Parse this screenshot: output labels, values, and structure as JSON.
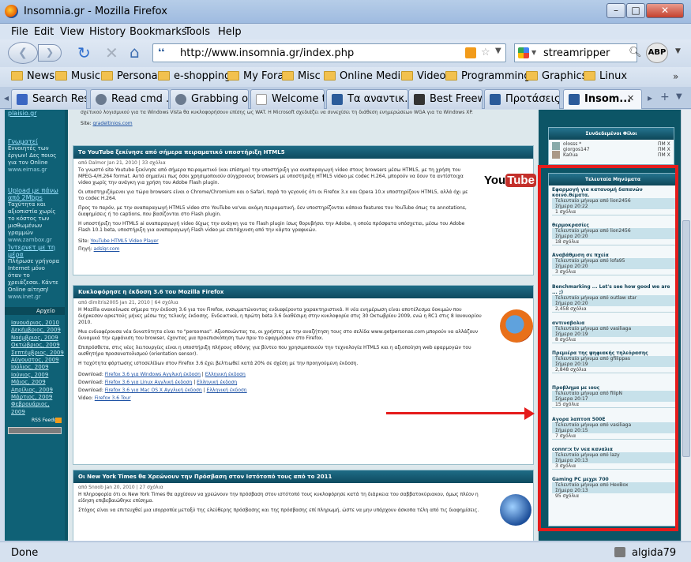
{
  "window": {
    "title": "Insomnia.gr - Mozilla Firefox"
  },
  "menubar": [
    "File",
    "Edit",
    "View",
    "History",
    "Bookmarks",
    "Tools",
    "Help"
  ],
  "navbar": {
    "url": "http://www.insomnia.gr/index.php",
    "search_value": "streamripper",
    "abp": "ABP"
  },
  "bookmarks": [
    "News",
    "Music",
    "Personal",
    "e-shopping",
    "My Fora",
    "Misc",
    "Online Media",
    "Video",
    "Programming",
    "Graphics",
    "Linux"
  ],
  "tabs": [
    "Search Res...",
    "Read cmd ...",
    "Grabbing o...",
    "Welcome t...",
    "Τα αναντικ...",
    "Best Freew...",
    "Προτάσεις...",
    "Insom..."
  ],
  "status": {
    "left": "Done",
    "right": "algida79"
  },
  "leftcol": {
    "top": "plaisio.gr",
    "ads": [
      {
        "title": "Γνωματεί",
        "text": "Εννοιητές των έργων! Δες ποιος για τον Online",
        "src": "www.eirnas.gr"
      },
      {
        "title": "Upload με πάνω από 2Mbps",
        "text": "Ταχύτητα και αξιοπιστία χωρίς το κόστος των μισθωμένων γραμμών",
        "src": "www.zambox.gr"
      },
      {
        "title": "Ίντερνετ με τη μέρα",
        "text": "Πλήρωσε γρήγορα Internet μόνο όταν το χρειάζεσαι. Κάντε Online αίτηση!",
        "src": "www.inet.gr"
      }
    ],
    "archive_title": "Αρχείο",
    "archive": [
      "Ιανουάριος, 2010",
      "Δεκέμβριος, 2009",
      "Νοέμβριος, 2009",
      "Οκτώβριος, 2009",
      "Σεπτέμβριος, 2009",
      "Αύγουστος, 2009",
      "Ιούλιος, 2009",
      "Ιούνιος, 2009",
      "Μάιος, 2009",
      "Απρίλιος, 2009",
      "Μάρτιος, 2009",
      "Φεβρουάριος, 2009"
    ],
    "rss": "RSS Feeds"
  },
  "posts": [
    {
      "title": "Το YouTube ξεκίνησε από σήμερα πειραματικό υποστήριξη HTML5",
      "meta": "από Dalmor Jan 21, 2010 | 33 σχόλια",
      "logo": "YouTube",
      "paras": [
        "Το γνωστό site Youtube ξεκίνησε από σήμερα πειραματικό (και επίσημο) την υποστήριξη για αναπαραγωγή video στους browsers μέσω HTML5, με τη χρήση του MPEG-4/H.264 format. Αυτό σημαίνει πως όσοι χρησιμοποιούν σύγχρονους browsers με υποστήριξη HTML5 video με codec H.264, μπορούν να δουν τα αντίστοιχα video χωρίς την ανάγκη για χρήση του Adobe Flash plugin.",
        "Οι υποστηριζόμενοι για τώρα browsers είναι ο Chrome/Chromium και ο Safari, παρά το γεγονός ότι οι Firefox 3.x και Opera 10.x υποστηρίζουν HTML5, αλλά όχι με το codec H.264.",
        "Προς το παρόν, με την αναπαραγωγή HTML5 video στο YouTube να'ναι ακόμη πειραματική, δεν υποστηρίζονται κάποια features του YouTube όπως τα annotations, διαφημίσεις ή το captions, που βασίζονται στο Flash plugin.",
        "Η υποστήριξη του HTML5 ai αναπαραγωγή video δίχως την ανάγκη για το Flash plugin ίσως θορυβήσει την Adobe, η οποία πρόσφατα υπόσχεται, μέσω του Adobe Flash 10.1 beta, υποστήριξη για αναπαραγωγή Flash video με επιτάχυνση από την κάρτα γραφικών."
      ],
      "links": [
        {
          "label": "Site:",
          "text": "YouTube HTML5 Video Player"
        },
        {
          "label": "Πηγή:",
          "text": "adslgr.com"
        }
      ]
    },
    {
      "title": "Κυκλοφόρησε η έκδοση 3.6 του Mozilla Firefox",
      "meta": "από dimitris2005 Jan 21, 2010 | 64 σχόλια",
      "paras": [
        "Η Mozilla ανακοίνωσε σήμερα την έκδοση 3.6 για τον Firefox, ενσωματώνοντας ενδιαφέροντα χαρακτηριστικά. Η νέα ενημέρωση είναι αποτέλεσμα δοκιμών που διήρκεσαν αρκετούς μήνες μέσω της τελικής έκδοσης. Ενδεικτικά, η πρώτη beta 3.6 διαθέσιμη στην κυκλοφορία στις 30 Οκτωβρίου 2009, ενώ η RC1 στις 8 Ιανουαρίου 2010.",
        "Μια ενδιαφέρουσα νέα δυνατότητα είναι το \"persomas\". Αξιοποιώντας τα, οι χρήστες με την αναζήτηση τους στο σελίδα www.getpersonas.com μπορούν να αλλάζουν δυναμικά την εμφάνιση του browser, έχοντας μια προεπισκόπηση των πριν το εφαρμόσουν στο Firefox.",
        "Επιπρόσθετα, στις νέες λειτουργίες είναι η υποστήριξη πλήρους οθόνης για βίντεο που χρησιμοποιούν την τεχνολογία HTML5 και η αξιοποίηση web εφαρμογών του αισθητήρα προσανατολισμού (orientation sensor).",
        "Η ταχύτητα φόρτωσης ιστοσελίδων στον Firefox 3.6 έχει βελτιωθεί κατά 20% σε σχέση με την προηγούμενη έκδοση."
      ],
      "downloads": [
        {
          "label": "Download:",
          "links": [
            "Firefox 3.6 για Windows Αγγλική έκδοση",
            "Ελληνική έκδοση"
          ]
        },
        {
          "label": "Download:",
          "links": [
            "Firefox 3.6 για Linux Αγγλική έκδοση",
            "Ελληνική έκδοση"
          ]
        },
        {
          "label": "Download:",
          "links": [
            "Firefox 3.6 για Mac OS X Αγγλική έκδοση",
            "Ελληνική έκδοση"
          ]
        },
        {
          "label": "Video:",
          "links": [
            "Firefox 3.6 Tour"
          ]
        }
      ]
    },
    {
      "title": "Οι New York Times θα Χρεώνουν την Πρόσβαση στον Ιστότοπό τους από το 2011",
      "meta": "από Snoob Jan 20, 2010 | 27 σχόλια",
      "paras": [
        "Η πληροφορία ότι οι New York Times θα αρχίσουν να χρεώνουν την πρόσβαση στον ιστότοπό τους κυκλοφόρησε κατά τη διάρκεια του σαββατοκύριακου, όμως πλέον η είδηση επιβεβαιώθηκε επίσημα.",
        "Στόχος είναι να επιτευχθεί μια ισορροπία μεταξύ της ελεύθερης πρόσβασης και της πρόσβασης επί πληρωμή, ώστε να μην υπάρχουν άσκοπα τέλη από τις διαφημίσεις."
      ]
    }
  ],
  "friends": {
    "title": "Συνδεδεμένοι Φίλοι",
    "items": [
      {
        "name": "olosss *",
        "action": "ΠΜ X"
      },
      {
        "name": "giorgos147",
        "action": "ΠΜ X"
      },
      {
        "name": "Ka0ua",
        "action": "ΠΜ X"
      }
    ]
  },
  "latest": {
    "title": "Τελευταία Μηνύματα",
    "items": [
      {
        "title": "Εφαρμογή για κατανομή δαπανών κοινό.θεματα.",
        "line": "Τελευταίο μήνυμα από lion2456",
        "time": "Σήμερα 20:22",
        "comments": "1 σχόλια"
      },
      {
        "title": "θερμοκρασίες",
        "line": "Τελευταίο μήνυμα από lion2456",
        "time": "Σήμερα 20:20",
        "comments": "18 σχόλια"
      },
      {
        "title": "Αναβάθμιση σε πχεία",
        "line": "Τελευταίο μήνυμα από lofa95",
        "time": "Σήμερα 20:20",
        "comments": "3 σχόλια"
      },
      {
        "title": "Benchmarking ... Let's see how good we are ... ;)",
        "line": "Τελευταίο μήνυμα από outlaw star",
        "time": "Σήμερα 20:20",
        "comments": "2,458 σχόλια"
      },
      {
        "title": "αντιναβολια",
        "line": "Τελευταίο μήνυμα από vasiliaga",
        "time": "Σήμερα 20:19",
        "comments": "8 σχόλια"
      },
      {
        "title": "Πρεμιέρα της ψηφιακής τηλεόρασης",
        "line": "Τελευταίο μήνυμα από gfilippas",
        "time": "Σήμερα 20:19",
        "comments": "2,848 σχόλια"
      },
      {
        "title": "Προβλημα με ιους",
        "line": "Τελευταίο μήνυμα από filipN",
        "time": "Σήμερα 20:17",
        "comments": "15 σχόλια"
      },
      {
        "title": "Αγορα λαπτοπ 500Ε",
        "line": "Τελευταίο μήνυμα από vasiliaga",
        "time": "Σήμερα 20:15",
        "comments": "7 σχόλια"
      },
      {
        "title": "connr:x tv νεα καναλια",
        "line": "Τελευταίο μήνυμα από lazy",
        "time": "Σήμερα 20:13",
        "comments": "3 σχόλια"
      },
      {
        "title": "Gaming PC μεχρι 700",
        "line": "Τελευταίο μήνυμα από HexBox",
        "time": "Σήμερα 20:13",
        "comments": "95 σχόλια"
      }
    ]
  },
  "colors": {
    "highlight": "#e51c1c",
    "page_bg": "#0c5566"
  }
}
